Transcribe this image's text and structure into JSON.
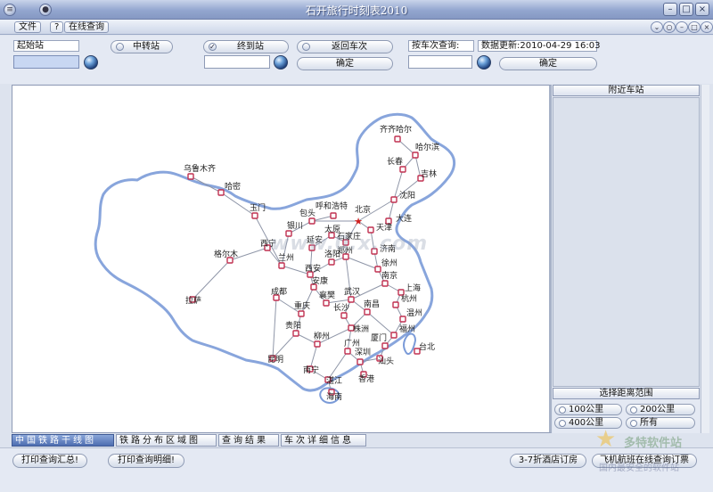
{
  "window": {
    "title": "石开旅行时刻表2010"
  },
  "menu": {
    "file": "文件",
    "help": "?",
    "online": "在线查询"
  },
  "search": {
    "start_label": "起始站",
    "transfer_label": "中转站",
    "end_label": "终到站",
    "return_label": "返回车次",
    "confirm_label": "确定",
    "train_query_label": "按车次查询:",
    "update_label": "数据更新:2010-04-29 16:03",
    "confirm2_label": "确定"
  },
  "map": {
    "watermark": "www.0.x.com",
    "cities": [
      {
        "name": "齐齐哈尔"
      },
      {
        "name": "哈尔滨"
      },
      {
        "name": "长春"
      },
      {
        "name": "吉林"
      },
      {
        "name": "沈阳"
      },
      {
        "name": "大连"
      },
      {
        "name": "乌鲁木齐"
      },
      {
        "name": "哈密"
      },
      {
        "name": "玉门"
      },
      {
        "name": "呼和浩特"
      },
      {
        "name": "包头"
      },
      {
        "name": "北京"
      },
      {
        "name": "银川"
      },
      {
        "name": "太原"
      },
      {
        "name": "天津"
      },
      {
        "name": "西宁"
      },
      {
        "name": "延安"
      },
      {
        "name": "石家庄"
      },
      {
        "name": "济南"
      },
      {
        "name": "格尔木"
      },
      {
        "name": "兰州"
      },
      {
        "name": "郑州"
      },
      {
        "name": "洛阳"
      },
      {
        "name": "徐州"
      },
      {
        "name": "西安"
      },
      {
        "name": "南京"
      },
      {
        "name": "安康"
      },
      {
        "name": "上海"
      },
      {
        "name": "拉萨"
      },
      {
        "name": "成都"
      },
      {
        "name": "武汉"
      },
      {
        "name": "杭州"
      },
      {
        "name": "襄樊"
      },
      {
        "name": "重庆"
      },
      {
        "name": "长沙"
      },
      {
        "name": "南昌"
      },
      {
        "name": "温州"
      },
      {
        "name": "株洲"
      },
      {
        "name": "贵阳"
      },
      {
        "name": "福州"
      },
      {
        "name": "柳州"
      },
      {
        "name": "广州"
      },
      {
        "name": "厦门"
      },
      {
        "name": "台北"
      },
      {
        "name": "昆明"
      },
      {
        "name": "深圳"
      },
      {
        "name": "汕头"
      },
      {
        "name": "南宁"
      },
      {
        "name": "香港"
      },
      {
        "name": "湛江"
      },
      {
        "name": "海南"
      }
    ]
  },
  "right": {
    "nearby_header": "附近车站",
    "range_header": "选择距离范围",
    "ranges": [
      "100公里",
      "200公里",
      "400公里",
      "所有"
    ]
  },
  "tabs": [
    "中国铁路干线图",
    "铁路分布区域图",
    "查询结果",
    "车次详细信息"
  ],
  "bottom": {
    "print_summary": "打印查询汇总!",
    "print_detail": "打印查询明细!",
    "hotel": "3-7折酒店订房",
    "flight": "飞机航班在线查询订票"
  },
  "brand": {
    "name": "多特软件站",
    "slogan": "国内最安全的软件站"
  }
}
